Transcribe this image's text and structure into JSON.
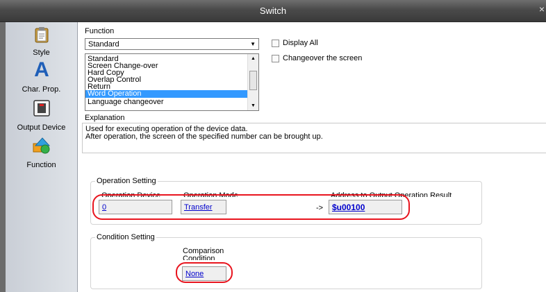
{
  "window": {
    "title": "Switch",
    "close_glyph": "×"
  },
  "sidebar": {
    "items": [
      {
        "label": "Style",
        "icon": "style-clipboard-icon"
      },
      {
        "label": "Char. Prop.",
        "icon": "char-prop-letter-a-icon",
        "glyph": "A"
      },
      {
        "label": "Output Device",
        "icon": "output-device-lamp-icon"
      },
      {
        "label": "Function",
        "icon": "function-shapes-icon"
      }
    ]
  },
  "function": {
    "label": "Function",
    "selected": "Standard",
    "display_all_label": "Display All",
    "changeover_label": "Changeover the screen",
    "list": [
      "Standard",
      "Screen Change-over",
      "Hard Copy",
      "Overlap Control",
      "Return",
      "Word Operation",
      "Language changeover"
    ],
    "list_selected_index": 5
  },
  "explanation": {
    "label": "Explanation",
    "lines": [
      "Used for executing operation of the device data.",
      "After operation, the screen of the specified number can be brought up."
    ]
  },
  "operation_setting": {
    "title": "Operation Setting",
    "device_label": "Operation Device",
    "device_value": "0",
    "mode_label": "Operation Mode",
    "mode_value": "Transfer",
    "arrow": "->",
    "result_label": "Address to Output Operation Result",
    "result_value": "$u00100"
  },
  "condition_setting": {
    "title": "Condition Setting",
    "comparison_label_1": "Comparison",
    "comparison_label_2": "Condition",
    "comparison_value": "None"
  },
  "colors": {
    "highlight_ring": "#e8141e",
    "selection": "#3399ff",
    "link": "#0000cc"
  }
}
